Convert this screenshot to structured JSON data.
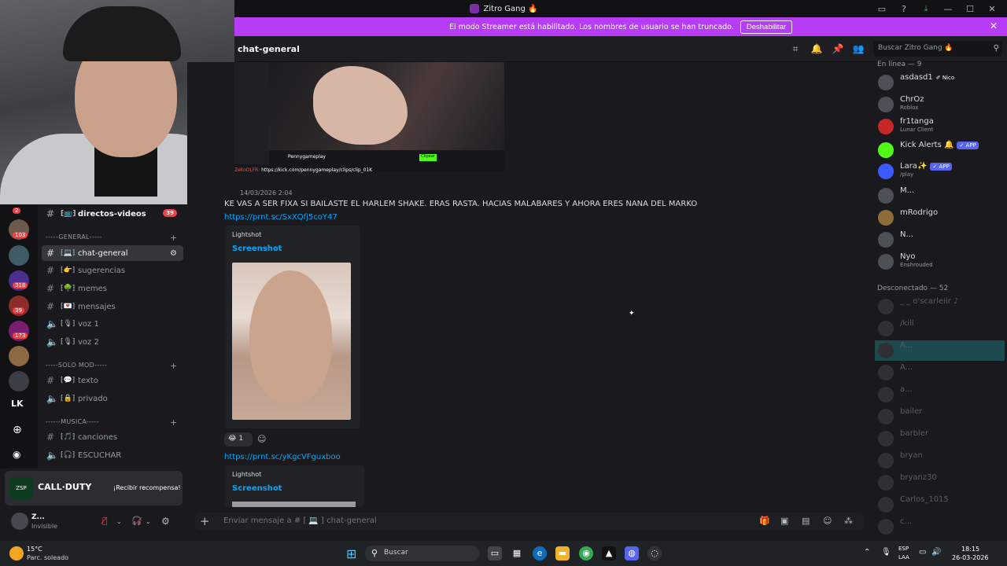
{
  "window": {
    "title": "Zitro Gang 🔥"
  },
  "banner": {
    "text": "El modo Streamer está habilitado. Los nombres de usuario se han truncado.",
    "button": "Deshabilitar"
  },
  "header": {
    "channel": "chat-general",
    "search_placeholder": "Buscar Zitro Gang 🔥"
  },
  "servers": [
    {
      "badge": "2"
    },
    {
      "badge": "103"
    },
    {
      "badge": ""
    },
    {
      "badge": "318"
    },
    {
      "badge": "39"
    },
    {
      "badge": "173"
    },
    {
      "badge": ""
    },
    {
      "badge": ""
    }
  ],
  "rail": {
    "lk": "LK"
  },
  "channels": {
    "directos": {
      "label": "directos-videos",
      "badge": "39"
    },
    "cat_general": "-----GENERAL-----",
    "chat_general": "chat-general",
    "sugerencias": "sugerencias",
    "memes": "memes",
    "mensajes": "mensajes",
    "voz1": "voz 1",
    "voz2": "voz 2",
    "cat_solo_mod": "-----SOLO MOD-----",
    "texto": "texto",
    "privado": "privado",
    "cat_musica": "------MUSICA-----",
    "canciones": "canciones",
    "escuchar": "ESCUCHAR"
  },
  "promo": {
    "logo": "ZSP",
    "title": "CALL·DUTY",
    "cta": "¡Recibir recompensa!"
  },
  "user": {
    "name": "Z...",
    "status": "Invisible"
  },
  "video": {
    "channel": "Pennygameplay",
    "link_user": "ZekoDLFR:",
    "link": "https://kick.com/pennygameplay/clips/clip_01K",
    "btn": "Clipear"
  },
  "message": {
    "time": "14/03/2026 2:04",
    "text": "KE VAS A SER FIXA SI BAILASTE EL HARLEM SHAKE. ERAS RASTA. HACIAS MALABARES Y AHORA ERES NANA DEL MARKO",
    "link1": "https://prnt.sc/SxXQfj5coY47",
    "link2": "https://prnt.sc/yKgcVFguxboo",
    "embed_provider": "Lightshot",
    "embed_title": "Screenshot",
    "reaction_count": "1"
  },
  "composer": {
    "placeholder": "Enviar mensaje a # ⁅ 💻 ⁆ chat-general"
  },
  "members": {
    "online_header": "En línea — 9",
    "online": [
      {
        "name": "asdasd1",
        "sub": "",
        "tag": "✐ Nico"
      },
      {
        "name": "ChrOz",
        "sub": "Roblox",
        "tag": ""
      },
      {
        "name": "fr1tanga",
        "sub": "Lunar Client",
        "tag": ""
      },
      {
        "name": "Kick Alerts 🔔",
        "sub": "",
        "tag": "✓ APP"
      },
      {
        "name": "Lara✨",
        "sub": "/play",
        "tag": "✓ APP"
      },
      {
        "name": "M...",
        "sub": "",
        "tag": ""
      },
      {
        "name": "mRodrigo",
        "sub": "",
        "tag": ""
      },
      {
        "name": "N...",
        "sub": "",
        "tag": ""
      },
      {
        "name": "Nyo",
        "sub": "Enshrouded",
        "tag": ""
      }
    ],
    "offline_header": "Desconectado — 52",
    "offline": [
      "_ _ o'scarleiir ♪",
      "/kill",
      "A...",
      "A...",
      "a...",
      "bailer",
      "barbler",
      "bryan",
      "bryanz30",
      "Carlos_1015",
      "c..."
    ]
  },
  "taskbar": {
    "temp": "15°C",
    "weather": "Parc. soleado",
    "search": "Buscar",
    "lang1": "ESP",
    "lang2": "LAA",
    "time": "18:15",
    "date": "26-03-2026"
  }
}
